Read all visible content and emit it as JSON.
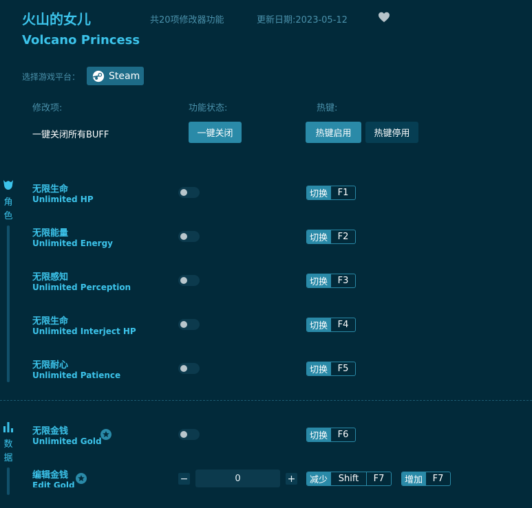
{
  "header": {
    "title_cn": "火山的女儿",
    "title_en": "Volcano Princess",
    "feature_count": "共20项修改器功能",
    "update_date": "更新日期:2023-05-12"
  },
  "platform": {
    "label": "选择游戏平台：",
    "button": "Steam"
  },
  "columns": {
    "item": "修改项:",
    "status": "功能状态:",
    "hotkey": "热键:"
  },
  "global_row": {
    "label": "一键关闭所有BUFF",
    "close_all": "一键关闭",
    "hotkey_on": "热键启用",
    "hotkey_off": "热键停用"
  },
  "sections": {
    "character": {
      "label_1": "角",
      "label_2": "色"
    },
    "data": {
      "label_1": "数",
      "label_2": "据"
    }
  },
  "items": [
    {
      "cn": "无限生命",
      "en": "Unlimited HP",
      "action": "切换",
      "key": "F1",
      "on": false
    },
    {
      "cn": "无限能量",
      "en": "Unlimited Energy",
      "action": "切换",
      "key": "F2",
      "on": false
    },
    {
      "cn": "无限感知",
      "en": "Unlimited Perception",
      "action": "切换",
      "key": "F3",
      "on": false
    },
    {
      "cn": "无限生命",
      "en": "Unlimited Interject HP",
      "action": "切换",
      "key": "F4",
      "on": false
    },
    {
      "cn": "无限耐心",
      "en": "Unlimited Patience",
      "action": "切换",
      "key": "F5",
      "on": false
    },
    {
      "cn": "无限金钱",
      "en": "Unlimited Gold",
      "action": "切换",
      "key": "F6",
      "on": false
    }
  ],
  "edit_gold": {
    "cn": "编辑金钱",
    "en": "Edit Gold",
    "minus": "−",
    "value": "0",
    "plus": "+",
    "decrease_label": "减少",
    "decrease_mod": "Shift",
    "decrease_key": "F7",
    "increase_label": "增加",
    "increase_key": "F7"
  },
  "colors": {
    "background": "#022a3a",
    "accent": "#3cc3ea",
    "button": "#2a8aa8"
  },
  "icons": {
    "favorite": "heart-icon",
    "steam": "steam-icon",
    "character": "character-icon",
    "data": "bar-chart-icon",
    "star": "star-badge-icon"
  }
}
